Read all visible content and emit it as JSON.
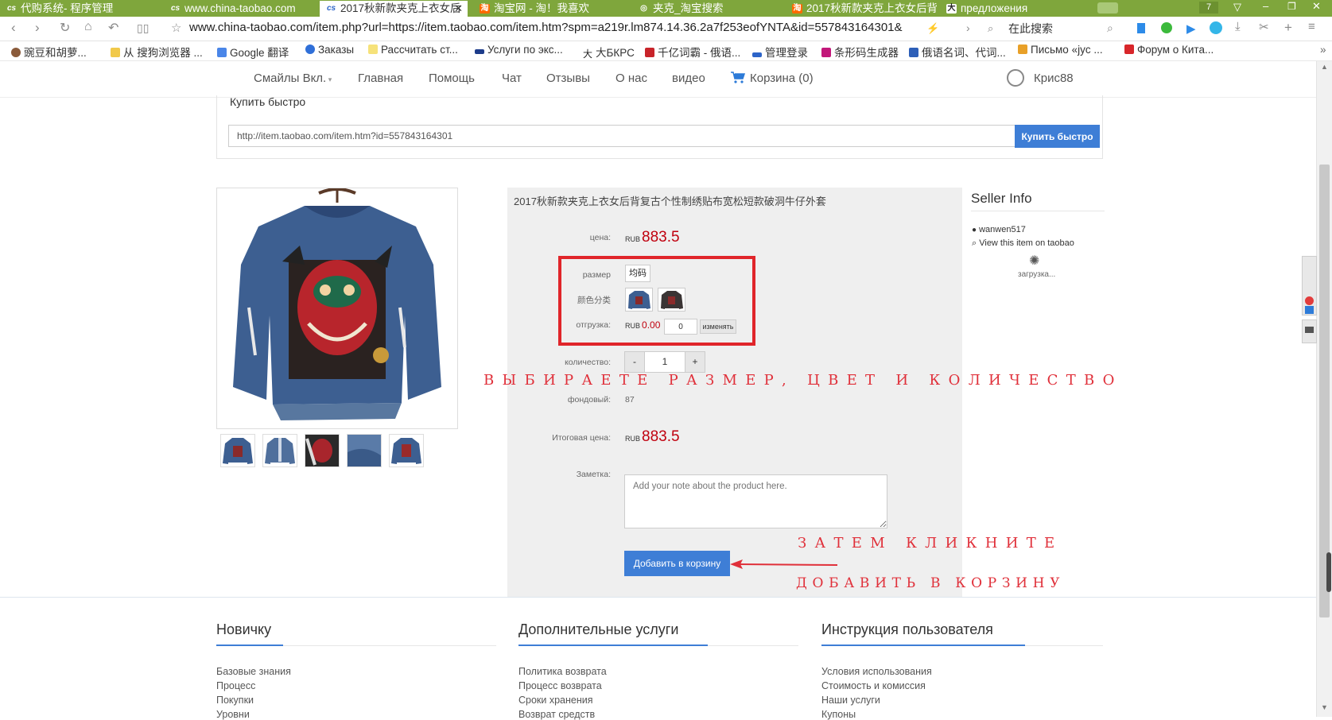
{
  "browser": {
    "tabs": [
      {
        "label": "代购系统- 程序管理",
        "icon": "cs"
      },
      {
        "label": "www.china-taobao.com",
        "icon": "cs"
      },
      {
        "label": "2017秋新款夹克上衣女后",
        "icon": "cs",
        "active": true
      },
      {
        "label": "淘宝网 - 淘！我喜欢",
        "icon": "taobao"
      },
      {
        "label": "夹克_淘宝搜索",
        "icon": "globe"
      },
      {
        "label": "2017秋新款夹克上衣女后背",
        "icon": "taobao"
      },
      {
        "label": "предложения",
        "icon": "kanji"
      }
    ],
    "tab_count": "7",
    "url": "www.china-taobao.com/item.php?url=https://item.taobao.com/item.htm?spm=a219r.lm874.14.36.2a7f253eofYNTA&id=557843164301&",
    "search_placeholder": "在此搜索",
    "bookmarks": [
      "豌豆和胡萝...",
      "从 搜狗浏览器 ...",
      "Google 翻译",
      "Заказы",
      "Рассчитать ст...",
      "Услуги по экс...",
      "大БКРС",
      "千亿词霸 - 俄语...",
      "管理登录",
      "条形码生成器",
      "俄语名词、代词...",
      "Письмо «jyc ...",
      "Форум о Кита..."
    ]
  },
  "site_nav": {
    "items": [
      "Смайлы Вкл.",
      "Главная",
      "Помощь",
      "Чат",
      "Отзывы",
      "О нас",
      "видео",
      "Корзина (0)"
    ],
    "user": "Крис88"
  },
  "quick_buy": {
    "title": "Купить быстро",
    "url_value": "http://item.taobao.com/item.htm?id=557843164301",
    "button": "Купить быстро"
  },
  "product": {
    "title": "2017秋新款夹克上衣女后背复古个性制绣贴布宽松短款破洞牛仔外套",
    "price_label": "цена:",
    "currency": "RUB",
    "price": "883.5",
    "size_label": "размер",
    "size_option": "均码",
    "color_label": "颜色分类",
    "shipping_label": "отгрузка:",
    "shipping_currency": "RUB",
    "shipping_price": "0.00",
    "shipping_input": "0",
    "shipping_change": "изменять",
    "qty_label": "количество:",
    "qty_minus": "-",
    "qty_value": "1",
    "qty_plus": "+",
    "stock_label": "фондовый:",
    "stock_value": "87",
    "total_label": "Итоговая цена:",
    "total_currency": "RUB",
    "total_price": "883.5",
    "note_label": "Заметка:",
    "note_placeholder": "Add your note about the product here.",
    "add_to_cart": "Добавить в корзину"
  },
  "annotations": {
    "choose": "ВЫБИРАЕТЕ РАЗМЕР, ЦВЕТ И КОЛИЧЕСТВО",
    "then_click": "ЗАТЕМ КЛИКНИТЕ",
    "add_to_cart": "ДОБАВИТЬ В КОРЗИНУ",
    "color": "#e0303a"
  },
  "seller": {
    "title": "Seller Info",
    "name": "wanwen517",
    "view_link": "View this item on taobao",
    "loading": "загрузка..."
  },
  "footer": {
    "columns": [
      {
        "title": "Новичку",
        "links": [
          "Базовые знания",
          "Процесс",
          "Покупки",
          "Уровни"
        ]
      },
      {
        "title": "Дополнительные услуги",
        "links": [
          "Политика возврата",
          "Процесс возврата",
          "Сроки хранения",
          "Возврат средств"
        ]
      },
      {
        "title": "Инструкция пользователя",
        "links": [
          "Условия использования",
          "Стоимость и комиссия",
          "Наши услуги",
          "Купоны"
        ]
      }
    ]
  },
  "colors": {
    "accent": "#3e7ed6",
    "price": "#c0000e",
    "browser_chrome": "#7fa63c"
  }
}
